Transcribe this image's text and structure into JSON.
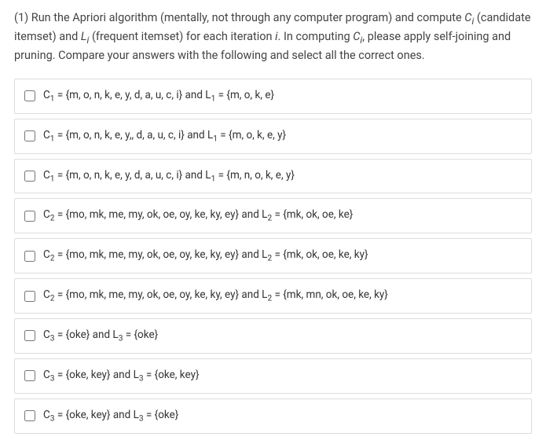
{
  "question": {
    "prompt_html": "(1) Run the Apriori algorithm (mentally, not through any computer program) and compute <i>C<sub>i</sub></i> (candidate itemset) and <i>L<sub>i</sub></i> (frequent itemset) for each iteration <i>i</i>. In computing <i>C<sub>i</sub></i>, please apply self-joining and pruning. Compare your answers with the following and select all the correct ones."
  },
  "options": [
    {
      "html": "C<sub>1</sub> = {m, o, n, k, e, y, d, a, u, c, i} and L<sub>1</sub> = {m, o, k, e}"
    },
    {
      "html": "C<sub>1</sub> = {m, o, n, k, e, y,, d, a, u, c, i} and L<sub>1</sub> = {m, o, k, e, y}"
    },
    {
      "html": "C<sub>1</sub> = {m, o, n, k, e, y, d, a, u, c, i} and L<sub>1</sub> = {m, n, o, k, e, y}"
    },
    {
      "html": "C<sub>2</sub> = {mo, mk, me, my, ok, oe, oy, ke, ky, ey} and L<sub>2</sub> = {mk, ok, oe, ke}"
    },
    {
      "html": "C<sub>2</sub> = {mo, mk, me, my, ok, oe, oy, ke, ky, ey} and L<sub>2</sub> = {mk, ok, oe, ke, ky}"
    },
    {
      "html": "C<sub>2</sub> = {mo, mk, me, my, ok, oe, oy, ke, ky, ey} and L<sub>2</sub> = {mk, mn, ok, oe, ke, ky}"
    },
    {
      "html": "C<sub>3</sub> = {oke}  and L<sub>3</sub> = {oke}"
    },
    {
      "html": "C<sub>3</sub> = {oke, key}  and L<sub>3</sub> = {oke, key}"
    },
    {
      "html": "C<sub>3</sub> = {oke, key}  and L<sub>3</sub> = {oke}"
    }
  ]
}
